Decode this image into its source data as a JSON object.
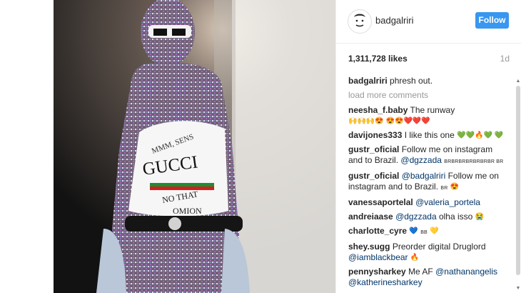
{
  "post": {
    "username": "badgalriri",
    "follow_label": "Follow",
    "likes": "1,311,728 likes",
    "age": "1d",
    "caption_user": "badgalriri",
    "caption_text": "phresh out.",
    "load_more": "load more comments",
    "shirt_text": [
      "MMM, SENS",
      "GUCCI",
      "NO THAT",
      "OMION"
    ]
  },
  "comments": [
    {
      "user": "neesha_f.baby",
      "text": "The runway",
      "emoji": "🙌🙌🙌😍 😍😍❤️❤️❤️"
    },
    {
      "user": "davijones333",
      "text": "I like this one",
      "emoji": "💚💚🔥💚 💚"
    },
    {
      "user": "gustr_oficial",
      "text": "Follow me on instagram and to Brazil.",
      "mention": "@dgzzada",
      "mention_full": "@guustr_oficial",
      "small": "BRBRBRBRBRBRBR BR"
    },
    {
      "user": "gustr_oficial",
      "text1": "@badgalriri",
      "text": "Follow me on instagram and to Brazil.",
      "small": "BR",
      "emoji": "😍"
    },
    {
      "user": "vanessaportelal",
      "mention": "@valeria_portela"
    },
    {
      "user": "andreiaase",
      "mention": "@dgzzada",
      "text": "olha isso",
      "emoji": "😭"
    },
    {
      "user": "charlotte_cyre",
      "emoji1": "💙",
      "small": "BB",
      "emoji2": "💛"
    },
    {
      "user": "shey.sugg",
      "text": "Preorder digital Druglord",
      "mention": "@iamblackbear",
      "emoji": "🔥"
    },
    {
      "user": "pennysharkey",
      "text": "Me AF",
      "mention": "@nathanangelis",
      "mention2": "@katherinesharkey"
    }
  ],
  "icons": {
    "avatar": "avatar-icon",
    "scroll_up": "scroll-up-arrow-icon",
    "scroll_down": "scroll-down-arrow-icon"
  },
  "colors": {
    "follow_bg": "#3897f0",
    "mention": "#003569",
    "muted": "#999999"
  }
}
